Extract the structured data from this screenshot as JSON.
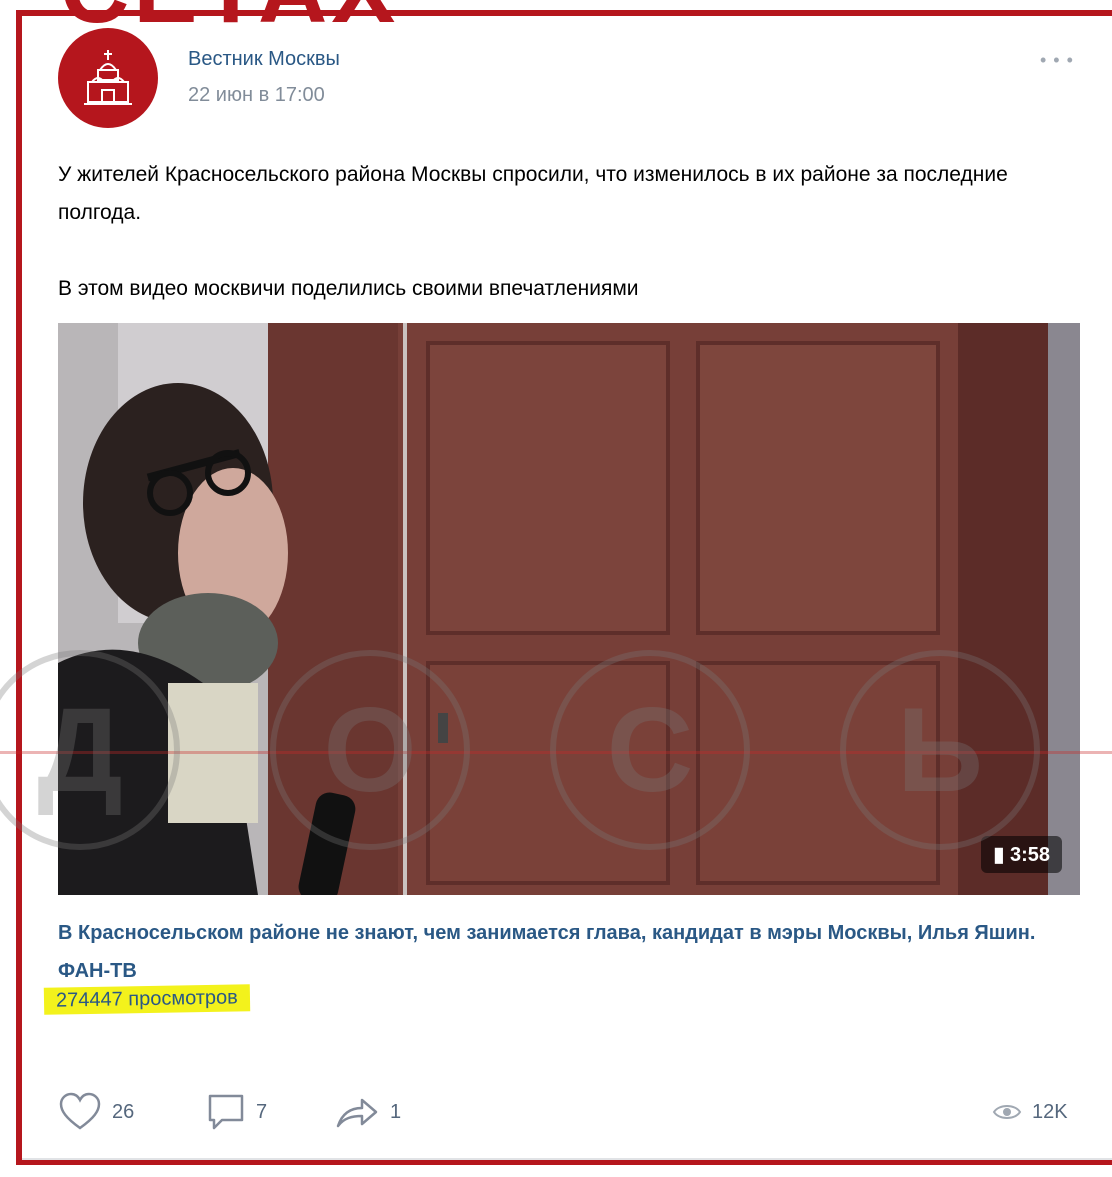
{
  "overlay": {
    "top_text": "СЕТАХ"
  },
  "post": {
    "author": "Вестник Москвы",
    "date": "22 июн в 17:00",
    "more_label": "• • •",
    "text_line1": "У жителей Красносельского района Москвы спросили, что изменилось в их районе за последние полгода.",
    "text_line2": "В этом видео москвичи поделились своими впечатлениями"
  },
  "video": {
    "duration": "3:58",
    "title": "В Красносельском районе не знают, чем занимается глава, кандидат в мэры Москвы, Илья Яшин. ФАН-ТВ",
    "views": "274447 просмотров"
  },
  "watermark": {
    "letters": [
      "Д",
      "О",
      "С",
      "Ь"
    ]
  },
  "actions": {
    "likes": "26",
    "comments": "7",
    "shares": "1",
    "views": "12K"
  },
  "colors": {
    "frame": "#b5161d",
    "link": "#2a5885",
    "highlight": "#f3f21c",
    "muted": "#818c99"
  }
}
